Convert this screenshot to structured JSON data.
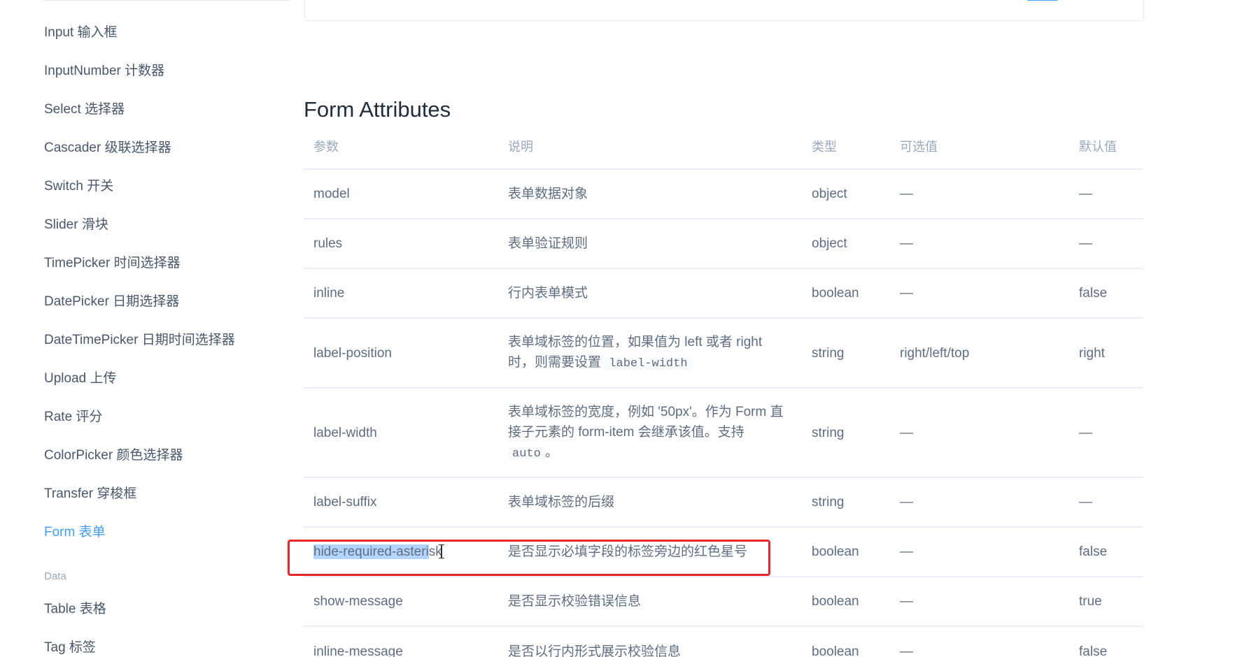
{
  "sidebar": {
    "items": [
      {
        "label": "Input 输入框"
      },
      {
        "label": "InputNumber 计数器"
      },
      {
        "label": "Select 选择器"
      },
      {
        "label": "Cascader 级联选择器"
      },
      {
        "label": "Switch 开关"
      },
      {
        "label": "Slider 滑块"
      },
      {
        "label": "TimePicker 时间选择器"
      },
      {
        "label": "DatePicker 日期选择器"
      },
      {
        "label": "DateTimePicker 日期时间选择器"
      },
      {
        "label": "Upload 上传"
      },
      {
        "label": "Rate 评分"
      },
      {
        "label": "ColorPicker 颜色选择器"
      },
      {
        "label": "Transfer 穿梭框"
      },
      {
        "label": "Form 表单",
        "active": true
      }
    ],
    "group_label": "Data",
    "group_items": [
      {
        "label": "Table 表格"
      },
      {
        "label": "Tag 标签"
      }
    ]
  },
  "main": {
    "section_title": "Form Attributes",
    "table": {
      "headers": [
        "参数",
        "说明",
        "类型",
        "可选值",
        "默认值"
      ],
      "rows": [
        {
          "param": "model",
          "desc": "表单数据对象",
          "type": "object",
          "options": "—",
          "default": "—"
        },
        {
          "param": "rules",
          "desc": "表单验证规则",
          "type": "object",
          "options": "—",
          "default": "—"
        },
        {
          "param": "inline",
          "desc": "行内表单模式",
          "type": "boolean",
          "options": "—",
          "default": "false"
        },
        {
          "param": "label-position",
          "desc_before": "表单域标签的位置，如果值为 left 或者 right 时，则需要设置",
          "desc_code": "label-width",
          "desc_after": "",
          "type": "string",
          "options": "right/left/top",
          "default": "right"
        },
        {
          "param": "label-width",
          "desc_before": "表单域标签的宽度，例如 '50px'。作为 Form 直接子元素的 form-item 会继承该值。支持",
          "desc_code": "auto",
          "desc_after": "。",
          "type": "string",
          "options": "—",
          "default": "—"
        },
        {
          "param": "label-suffix",
          "desc": "表单域标签的后缀",
          "type": "string",
          "options": "—",
          "default": "—"
        },
        {
          "param_selected": "hide-required-asteri",
          "param_rest": "sk",
          "desc": "是否显示必填字段的标签旁边的红色星号",
          "type": "boolean",
          "options": "—",
          "default": "false"
        },
        {
          "param": "show-message",
          "desc": "是否显示校验错误信息",
          "type": "boolean",
          "options": "—",
          "default": "true"
        },
        {
          "param": "inline-message",
          "desc": "是否以行内形式展示校验信息",
          "type": "boolean",
          "options": "—",
          "default": "false"
        }
      ]
    }
  },
  "colors": {
    "accent": "#409eff",
    "highlight": "#e8262c",
    "selection": "#b4d5fe"
  }
}
